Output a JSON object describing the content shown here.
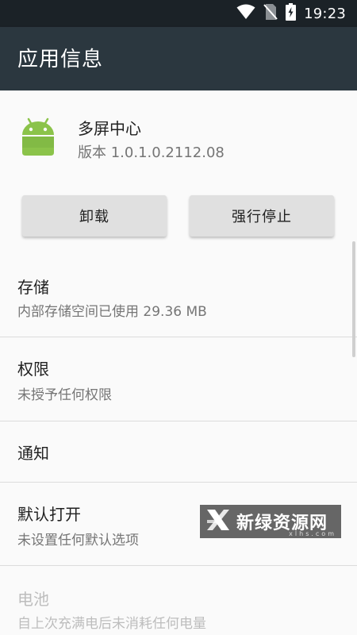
{
  "status_bar": {
    "time": "19:23",
    "icons": [
      "wifi-icon",
      "no-sim-icon",
      "battery-charging-icon"
    ]
  },
  "toolbar": {
    "title": "应用信息"
  },
  "app": {
    "name": "多屏中心",
    "version": "版本 1.0.1.0.2112.08",
    "icon": "android-robot-icon",
    "icon_color": "#8bc34a"
  },
  "buttons": {
    "uninstall_label": "卸载",
    "force_stop_label": "强行停止"
  },
  "list": {
    "storage": {
      "title": "存储",
      "subtitle": "内部存储空间已使用 29.36 MB"
    },
    "permissions": {
      "title": "权限",
      "subtitle": "未授予任何权限"
    },
    "notifications": {
      "title": "通知"
    },
    "open_by_default": {
      "title": "默认打开",
      "subtitle": "未设置任何默认选项"
    },
    "battery": {
      "title": "电池",
      "subtitle": "自上次充满电后未消耗任何电量"
    }
  },
  "watermark": {
    "text": "新绿资源网",
    "sub": "xlhs.com",
    "logo": "xl-logo-icon"
  },
  "colors": {
    "status_bar_bg": "#1b2227",
    "toolbar_bg": "#2b373f",
    "background": "#fafafa",
    "button_bg": "#e0e0e0"
  }
}
